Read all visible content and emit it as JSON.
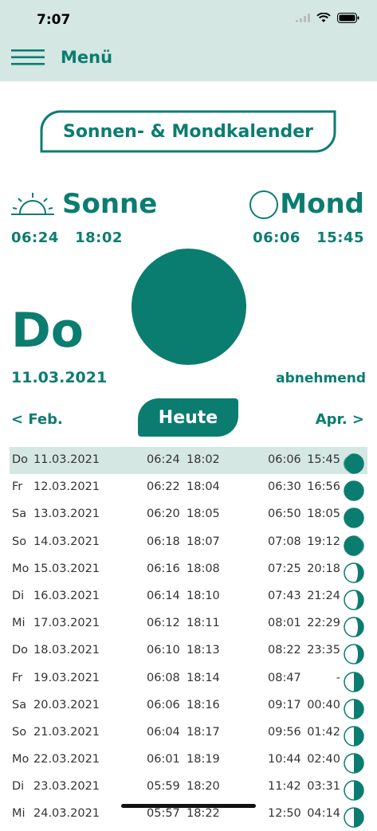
{
  "status": {
    "time": "7:07"
  },
  "header": {
    "menu_label": "Menü"
  },
  "title": "Sonnen- & Mondkalender",
  "sun": {
    "label": "Sonne",
    "rise": "06:24",
    "set": "18:02"
  },
  "moon": {
    "label": "Mond",
    "rise": "06:06",
    "set": "15:45"
  },
  "current": {
    "day": "Do",
    "date": "11.03.2021",
    "phase": "abnehmend"
  },
  "nav": {
    "prev": "< Feb.",
    "today": "Heute",
    "next": "Apr. >"
  },
  "rows": [
    {
      "day": "Do",
      "date": "11.03.2021",
      "sunrise": "06:24",
      "sunset": "18:02",
      "moonrise": "06:06",
      "moonset": "15:45",
      "phase": "waning-sliver"
    },
    {
      "day": "Fr",
      "date": "12.03.2021",
      "sunrise": "06:22",
      "sunset": "18:04",
      "moonrise": "06:30",
      "moonset": "16:56",
      "phase": "new"
    },
    {
      "day": "Sa",
      "date": "13.03.2021",
      "sunrise": "06:20",
      "sunset": "18:05",
      "moonrise": "06:50",
      "moonset": "18:05",
      "phase": "new"
    },
    {
      "day": "So",
      "date": "14.03.2021",
      "sunrise": "06:18",
      "sunset": "18:07",
      "moonrise": "07:08",
      "moonset": "19:12",
      "phase": "waxing-sliver"
    },
    {
      "day": "Mo",
      "date": "15.03.2021",
      "sunrise": "06:16",
      "sunset": "18:08",
      "moonrise": "07:25",
      "moonset": "20:18",
      "phase": "waxing-crescent"
    },
    {
      "day": "Di",
      "date": "16.03.2021",
      "sunrise": "06:14",
      "sunset": "18:10",
      "moonrise": "07:43",
      "moonset": "21:24",
      "phase": "waxing-crescent"
    },
    {
      "day": "Mi",
      "date": "17.03.2021",
      "sunrise": "06:12",
      "sunset": "18:11",
      "moonrise": "08:01",
      "moonset": "22:29",
      "phase": "waxing-crescent"
    },
    {
      "day": "Do",
      "date": "18.03.2021",
      "sunrise": "06:10",
      "sunset": "18:13",
      "moonrise": "08:22",
      "moonset": "23:35",
      "phase": "waxing-crescent"
    },
    {
      "day": "Fr",
      "date": "19.03.2021",
      "sunrise": "06:08",
      "sunset": "18:14",
      "moonrise": "08:47",
      "moonset": "-",
      "phase": "waxing-half"
    },
    {
      "day": "Sa",
      "date": "20.03.2021",
      "sunrise": "06:06",
      "sunset": "18:16",
      "moonrise": "09:17",
      "moonset": "00:40",
      "phase": "waxing-half"
    },
    {
      "day": "So",
      "date": "21.03.2021",
      "sunrise": "06:04",
      "sunset": "18:17",
      "moonrise": "09:56",
      "moonset": "01:42",
      "phase": "waxing-half"
    },
    {
      "day": "Mo",
      "date": "22.03.2021",
      "sunrise": "06:01",
      "sunset": "18:19",
      "moonrise": "10:44",
      "moonset": "02:40",
      "phase": "waxing-half"
    },
    {
      "day": "Di",
      "date": "23.03.2021",
      "sunrise": "05:59",
      "sunset": "18:20",
      "moonrise": "11:42",
      "moonset": "03:31",
      "phase": "waxing-half"
    },
    {
      "day": "Mi",
      "date": "24.03.2021",
      "sunrise": "05:57",
      "sunset": "18:22",
      "moonrise": "12:50",
      "moonset": "04:14",
      "phase": "waxing-half"
    }
  ],
  "colors": {
    "accent": "#0b7d70",
    "header_bg": "#d4e7e3",
    "selected_row": "#d4e7e3"
  }
}
